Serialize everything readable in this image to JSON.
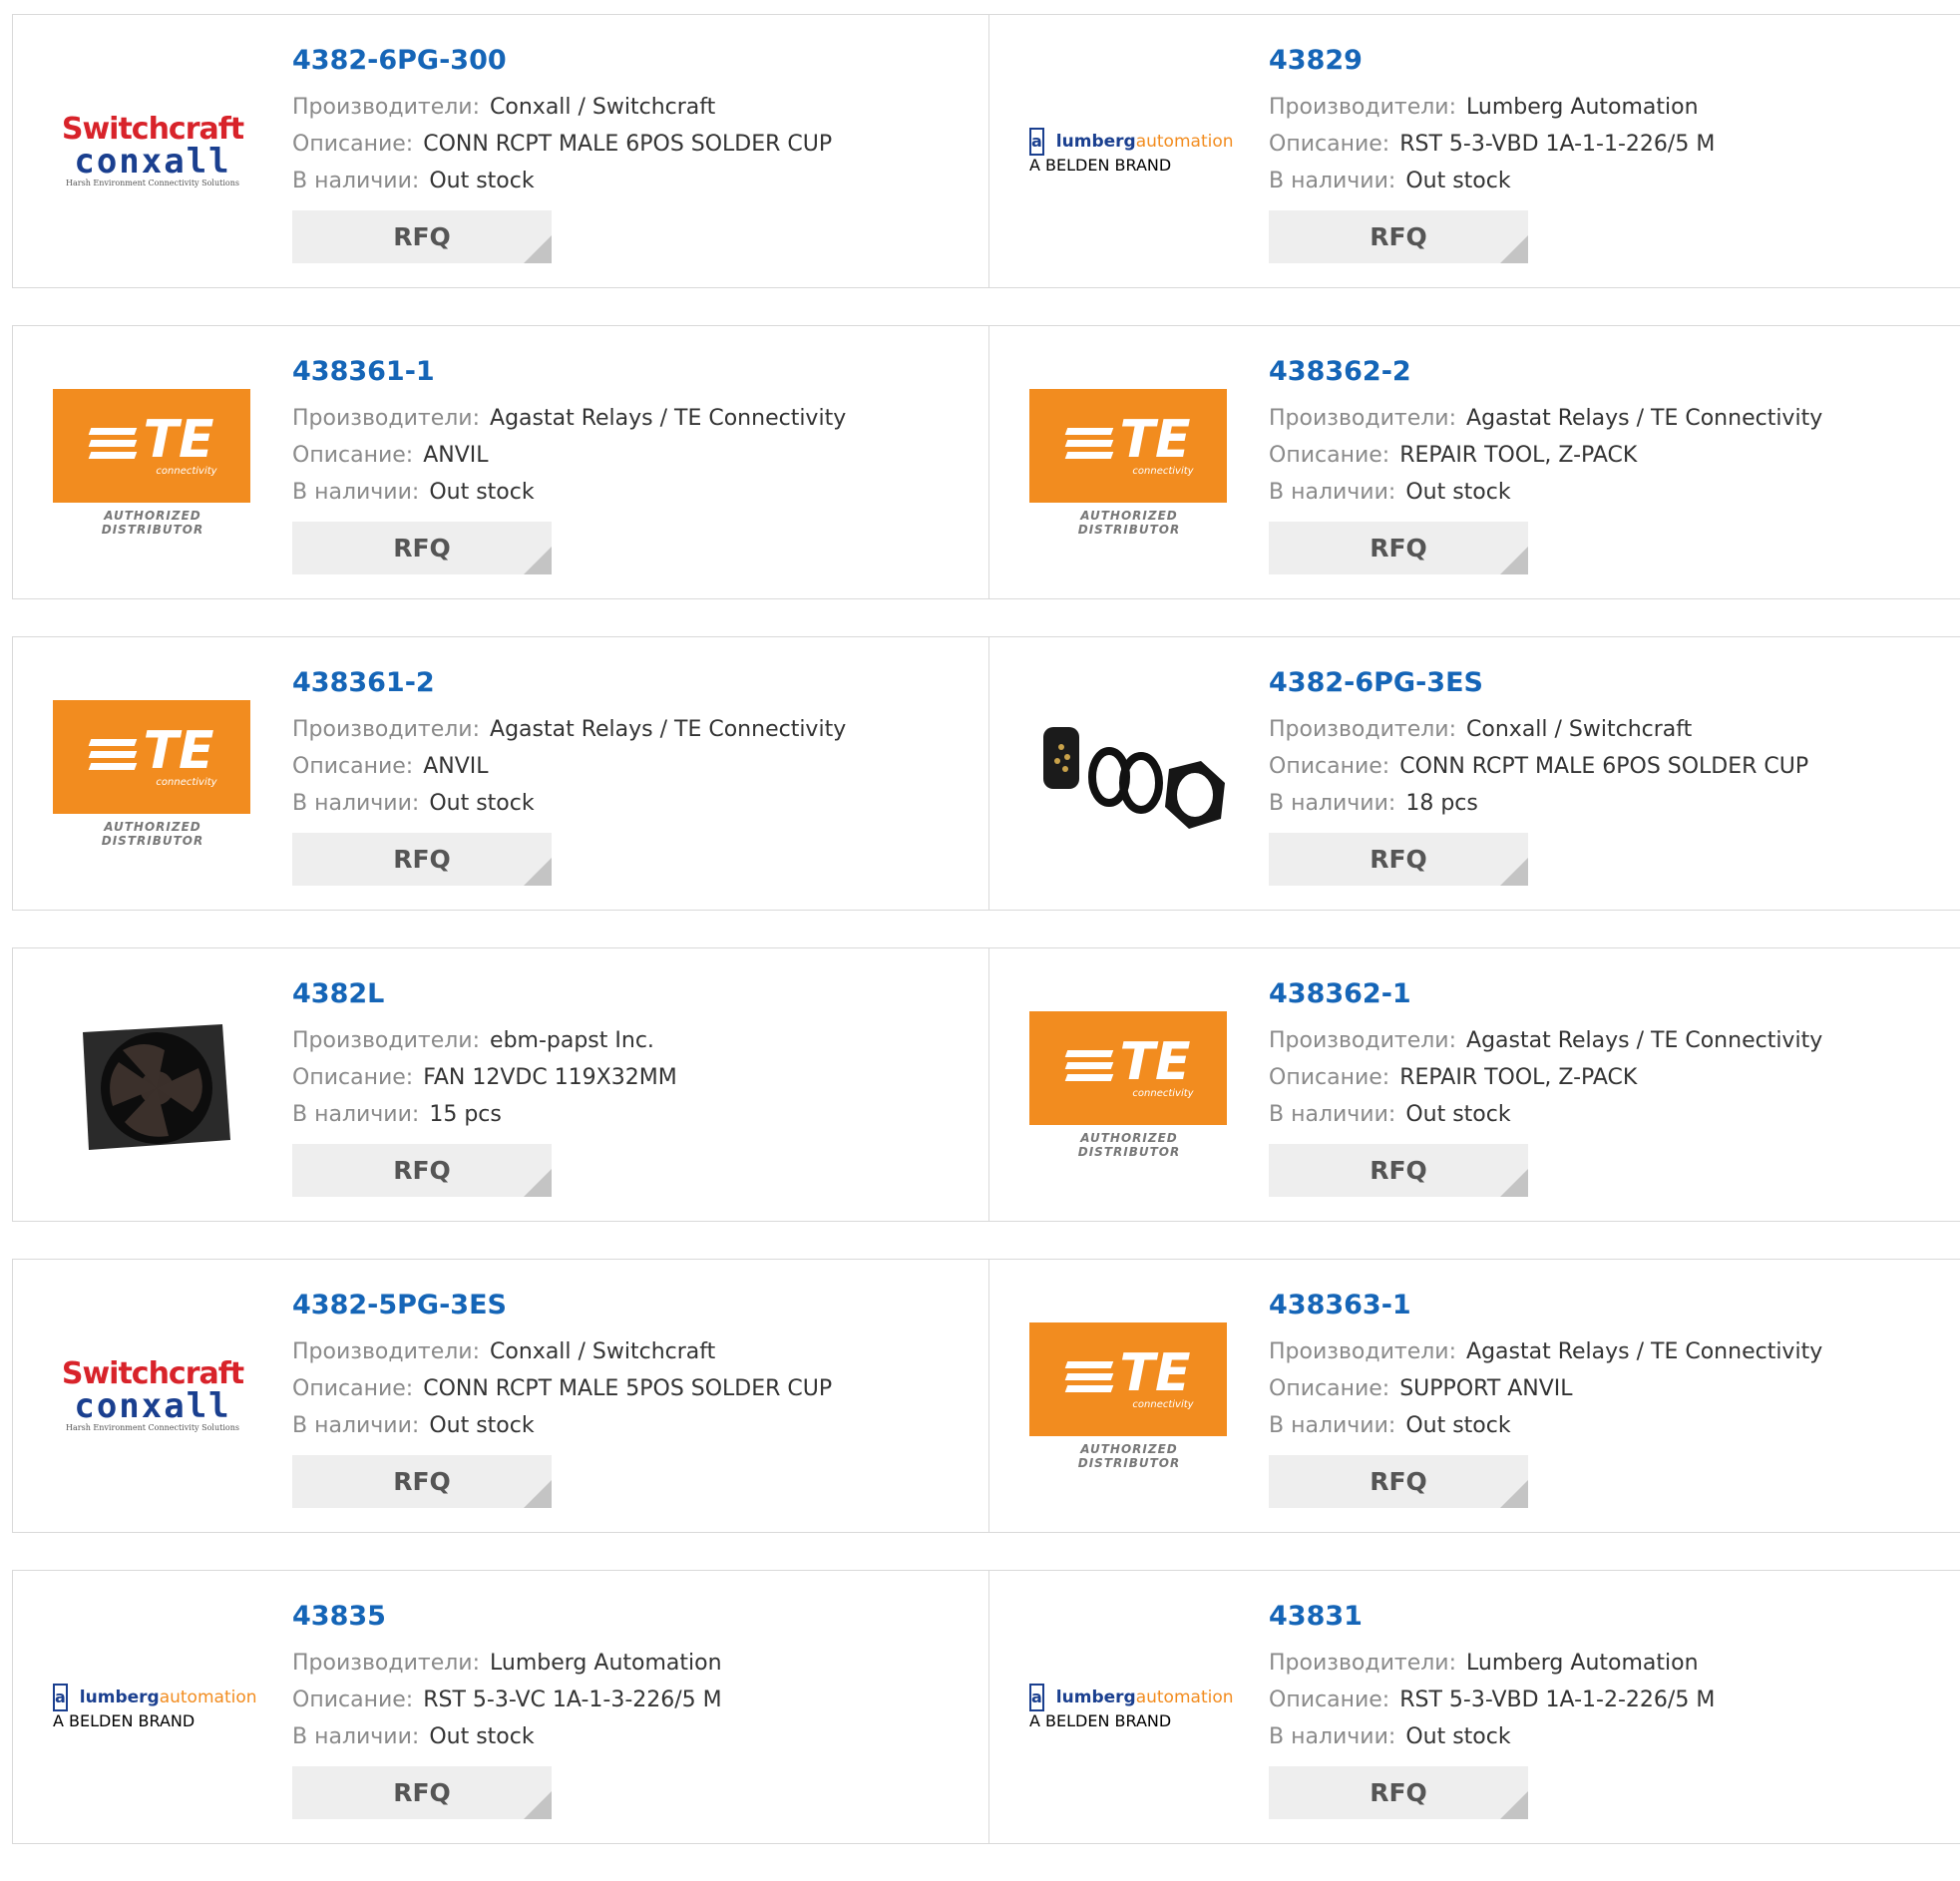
{
  "labels": {
    "manufacturer": "Производители:",
    "description": "Описание:",
    "stock": "В наличии:",
    "rfq": "RFQ"
  },
  "brand_logos": {
    "switchcraft": {
      "line1": "Switchcraft",
      "line2": "conxall",
      "tagline": "Harsh Environment Connectivity Solutions"
    },
    "te": {
      "mark": "TE",
      "sub": "connectivity",
      "badge": "AUTHORIZED DISTRIBUTOR"
    },
    "lumberg": {
      "word1": "lumberg",
      "word2": "automation",
      "tagline": "A BELDEN BRAND"
    }
  },
  "colors": {
    "part_link": "#1565b7",
    "te_orange": "#f28c1f",
    "switchcraft_red": "#d8232a",
    "conxall_blue": "#1a3f8f"
  },
  "products": [
    {
      "part": "4382-6PG-300",
      "manufacturer": "Conxall / Switchcraft",
      "description": "CONN RCPT MALE 6POS SOLDER CUP",
      "stock": "Out stock",
      "logo": "switchcraft"
    },
    {
      "part": "43829",
      "manufacturer": "Lumberg Automation",
      "description": "RST 5-3-VBD 1A-1-1-226/5 M",
      "stock": "Out stock",
      "logo": "lumberg"
    },
    {
      "part": "438361-1",
      "manufacturer": "Agastat Relays / TE Connectivity",
      "description": "ANVIL",
      "stock": "Out stock",
      "logo": "te"
    },
    {
      "part": "438362-2",
      "manufacturer": "Agastat Relays / TE Connectivity",
      "description": "REPAIR TOOL, Z-PACK",
      "stock": "Out stock",
      "logo": "te"
    },
    {
      "part": "438361-2",
      "manufacturer": "Agastat Relays / TE Connectivity",
      "description": "ANVIL",
      "stock": "Out stock",
      "logo": "te"
    },
    {
      "part": "4382-6PG-3ES",
      "manufacturer": "Conxall / Switchcraft",
      "description": "CONN RCPT MALE 6POS SOLDER CUP",
      "stock": "18 pcs",
      "logo": "connector-photo"
    },
    {
      "part": "4382L",
      "manufacturer": "ebm-papst Inc.",
      "description": "FAN 12VDC 119X32MM",
      "stock": "15 pcs",
      "logo": "fan-photo"
    },
    {
      "part": "438362-1",
      "manufacturer": "Agastat Relays / TE Connectivity",
      "description": "REPAIR TOOL, Z-PACK",
      "stock": "Out stock",
      "logo": "te"
    },
    {
      "part": "4382-5PG-3ES",
      "manufacturer": "Conxall / Switchcraft",
      "description": "CONN RCPT MALE 5POS SOLDER CUP",
      "stock": "Out stock",
      "logo": "switchcraft"
    },
    {
      "part": "438363-1",
      "manufacturer": "Agastat Relays / TE Connectivity",
      "description": "SUPPORT ANVIL",
      "stock": "Out stock",
      "logo": "te"
    },
    {
      "part": "43835",
      "manufacturer": "Lumberg Automation",
      "description": "RST 5-3-VC 1A-1-3-226/5 M",
      "stock": "Out stock",
      "logo": "lumberg"
    },
    {
      "part": "43831",
      "manufacturer": "Lumberg Automation",
      "description": "RST 5-3-VBD 1A-1-2-226/5 M",
      "stock": "Out stock",
      "logo": "lumberg"
    }
  ]
}
